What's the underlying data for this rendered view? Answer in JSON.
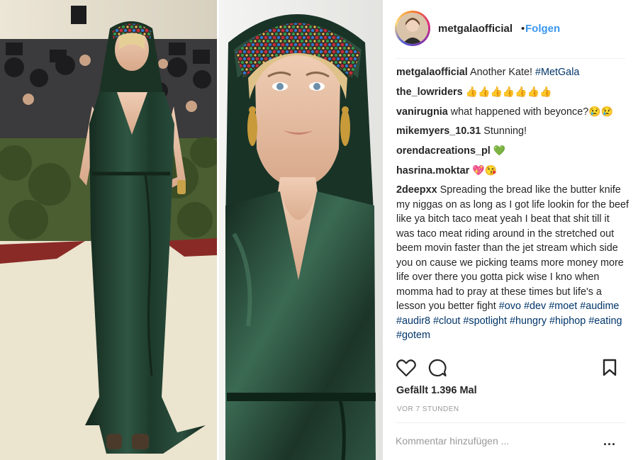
{
  "header": {
    "username": "metgalaofficial",
    "separator": "•",
    "follow_label": "Folgen"
  },
  "comments": [
    {
      "user": "metgalaofficial",
      "text": "Another Kate! ",
      "hashtags": [
        "#MetGala"
      ],
      "emoji": ""
    },
    {
      "user": "the_lowriders",
      "text": "",
      "hashtags": [],
      "emoji": "👍👍👍👍👍👍👍"
    },
    {
      "user": "vanirugnia",
      "text": "what happened with beyonce?",
      "hashtags": [],
      "emoji": "😢😢"
    },
    {
      "user": "mikemyers_10.31",
      "text": "Stunning!",
      "hashtags": [],
      "emoji": ""
    },
    {
      "user": "orendacreations_pl",
      "text": "",
      "hashtags": [],
      "emoji": "💚"
    },
    {
      "user": "hasrina.moktar",
      "text": "",
      "hashtags": [],
      "emoji": "💖😘"
    },
    {
      "user": "2deepxx",
      "text": "Spreading the bread like the butter knife my niggas on as long as I got life lookin for the beef like ya bitch taco meat yeah I beat that shit till it was taco meat riding around in the stretched out beem movin faster than the jet stream which side you on cause we picking teams more money more life over there you gotta pick wise I kno when momma had to pray at these times but life's a lesson you better fight",
      "hashtags": [
        "#ovo",
        "#dev",
        "#moet",
        "#audime",
        "#audir8",
        "#clout",
        "#spotlight",
        "#hungry",
        "#hiphop",
        "#eating",
        "#gotem"
      ],
      "emoji": ""
    }
  ],
  "icons": {
    "like": "heart-icon",
    "comment": "comment-icon",
    "save": "bookmark-icon",
    "options": "more-options-icon"
  },
  "likes_label": "Gefällt 1.396 Mal",
  "timestamp": "VOR 7 STUNDEN",
  "add_comment": {
    "placeholder": "Kommentar hinzufügen ...",
    "more_label": "..."
  },
  "colors": {
    "link_blue": "#3897f0",
    "hashtag": "#003569",
    "muted": "#999999",
    "dress_green": "#1f3a2c"
  }
}
